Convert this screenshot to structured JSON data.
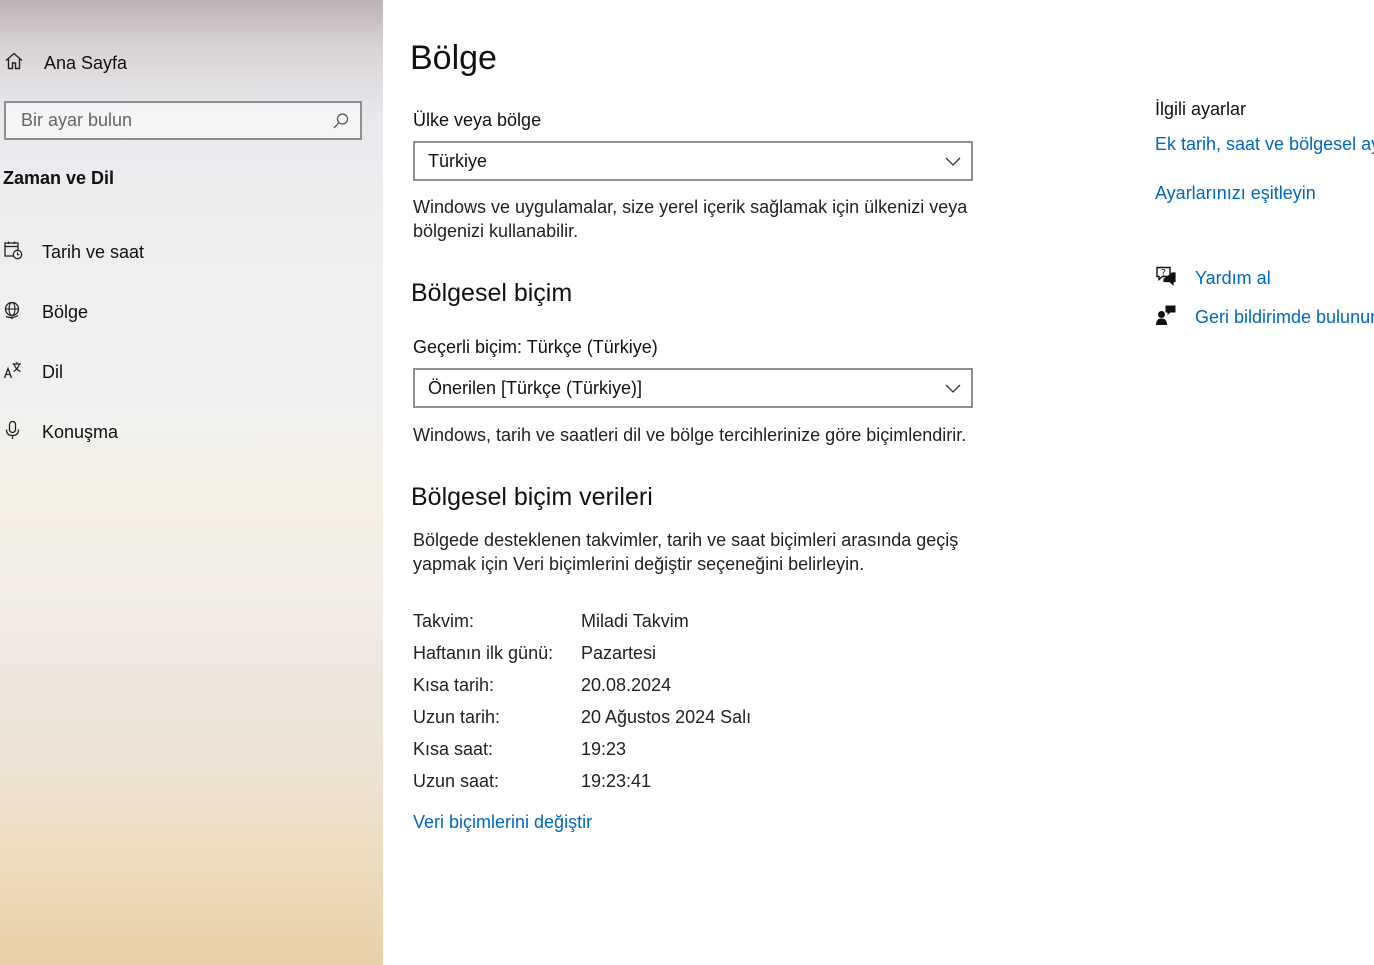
{
  "sidebar": {
    "home_label": "Ana Sayfa",
    "search_placeholder": "Bir ayar bulun",
    "section_title": "Zaman ve Dil",
    "items": [
      {
        "label": "Tarih ve saat",
        "icon": "calendar-clock-icon"
      },
      {
        "label": "Bölge",
        "icon": "globe-icon"
      },
      {
        "label": "Dil",
        "icon": "language-icon"
      },
      {
        "label": "Konuşma",
        "icon": "microphone-icon"
      }
    ]
  },
  "main": {
    "title": "Bölge",
    "country": {
      "label": "Ülke veya bölge",
      "value": "Türkiye",
      "description": "Windows ve uygulamalar, size yerel içerik sağlamak için ülkenizi veya bölgenizi kullanabilir."
    },
    "regional_format": {
      "heading": "Bölgesel biçim",
      "current_label": "Geçerli biçim: Türkçe (Türkiye)",
      "value": "Önerilen [Türkçe (Türkiye)]",
      "description": "Windows, tarih ve saatleri dil ve bölge tercihlerinize göre biçimlendirir."
    },
    "format_data": {
      "heading": "Bölgesel biçim verileri",
      "description": "Bölgede desteklenen takvimler, tarih ve saat biçimleri arasında geçiş yapmak için Veri biçimlerini değiştir seçeneğini belirleyin.",
      "rows": [
        {
          "key": "Takvim:",
          "value": "Miladi Takvim"
        },
        {
          "key": "Haftanın ilk günü:",
          "value": "Pazartesi"
        },
        {
          "key": "Kısa tarih:",
          "value": "20.08.2024"
        },
        {
          "key": "Uzun tarih:",
          "value": "20 Ağustos 2024 Salı"
        },
        {
          "key": "Kısa saat:",
          "value": "19:23"
        },
        {
          "key": "Uzun saat:",
          "value": "19:23:41"
        }
      ],
      "change_link": "Veri biçimlerini değiştir"
    }
  },
  "related": {
    "title": "İlgili ayarlar",
    "links": [
      "Ek tarih, saat ve bölgesel ayarlar",
      "Ayarlarınızı eşitleyin"
    ],
    "help_label": "Yardım al",
    "feedback_label": "Geri bildirimde bulunun"
  },
  "colors": {
    "accent": "#0067c0",
    "border": "#8f8f8f"
  }
}
